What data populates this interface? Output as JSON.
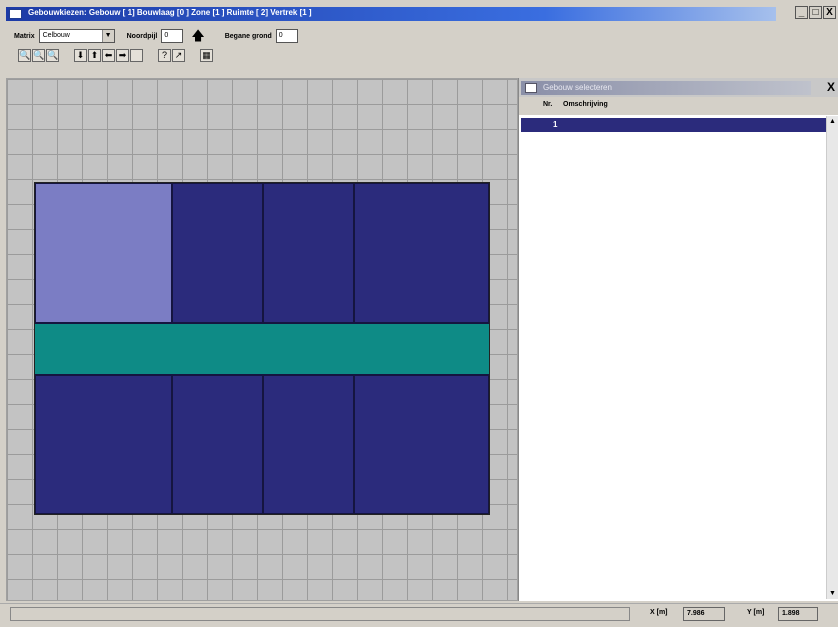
{
  "window": {
    "title": "Gebouwkiezen: Gebouw [ 1]  Bouwlaag [0  ]  Zone [1  ]  Ruimte [  2]  Vertrek [1  ]",
    "minimize": "_",
    "maximize": "□",
    "close": "X"
  },
  "toolbar": {
    "matrix_label": "Matrix",
    "matrix_value": "Celbouw",
    "northarrow_label": "Noordpijl",
    "northarrow_value": "0",
    "ground_label": "Begane grond",
    "ground_value": "0",
    "buttons": [
      "🔍",
      "🔍",
      "🔍",
      "⬇",
      "⬆",
      "⬅",
      "➡",
      "",
      "?",
      "↗",
      "▦"
    ]
  },
  "panel": {
    "title": "Gebouw selecteren",
    "close": "X",
    "columns": [
      "Nr.",
      "Omschrijving"
    ],
    "rows": [
      {
        "nr": "1",
        "desc": ""
      }
    ]
  },
  "status": {
    "x_label": "X [m]",
    "x_value": "7.986",
    "y_label": "Y [m]",
    "y_value": "1.898"
  },
  "colors": {
    "room": "#2b2b7c",
    "room_selected": "#7b7dc4",
    "corridor": "#0e8b86",
    "grid": "#c3c3c3"
  }
}
